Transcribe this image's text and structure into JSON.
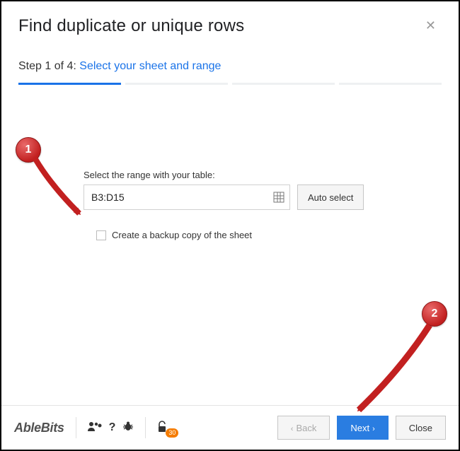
{
  "header": {
    "title": "Find duplicate or unique rows"
  },
  "step": {
    "prefix": "Step 1 of 4: ",
    "link": "Select your sheet and range",
    "current": 1,
    "total": 4
  },
  "range": {
    "label": "Select the range with your table:",
    "value": "B3:D15",
    "autoSelectLabel": "Auto select"
  },
  "backup": {
    "label": "Create a backup copy of the sheet",
    "checked": false
  },
  "footer": {
    "brand": "AbleBits",
    "badge": "30",
    "back": "Back",
    "next": "Next",
    "close": "Close"
  },
  "annotations": {
    "b1": "1",
    "b2": "2"
  }
}
